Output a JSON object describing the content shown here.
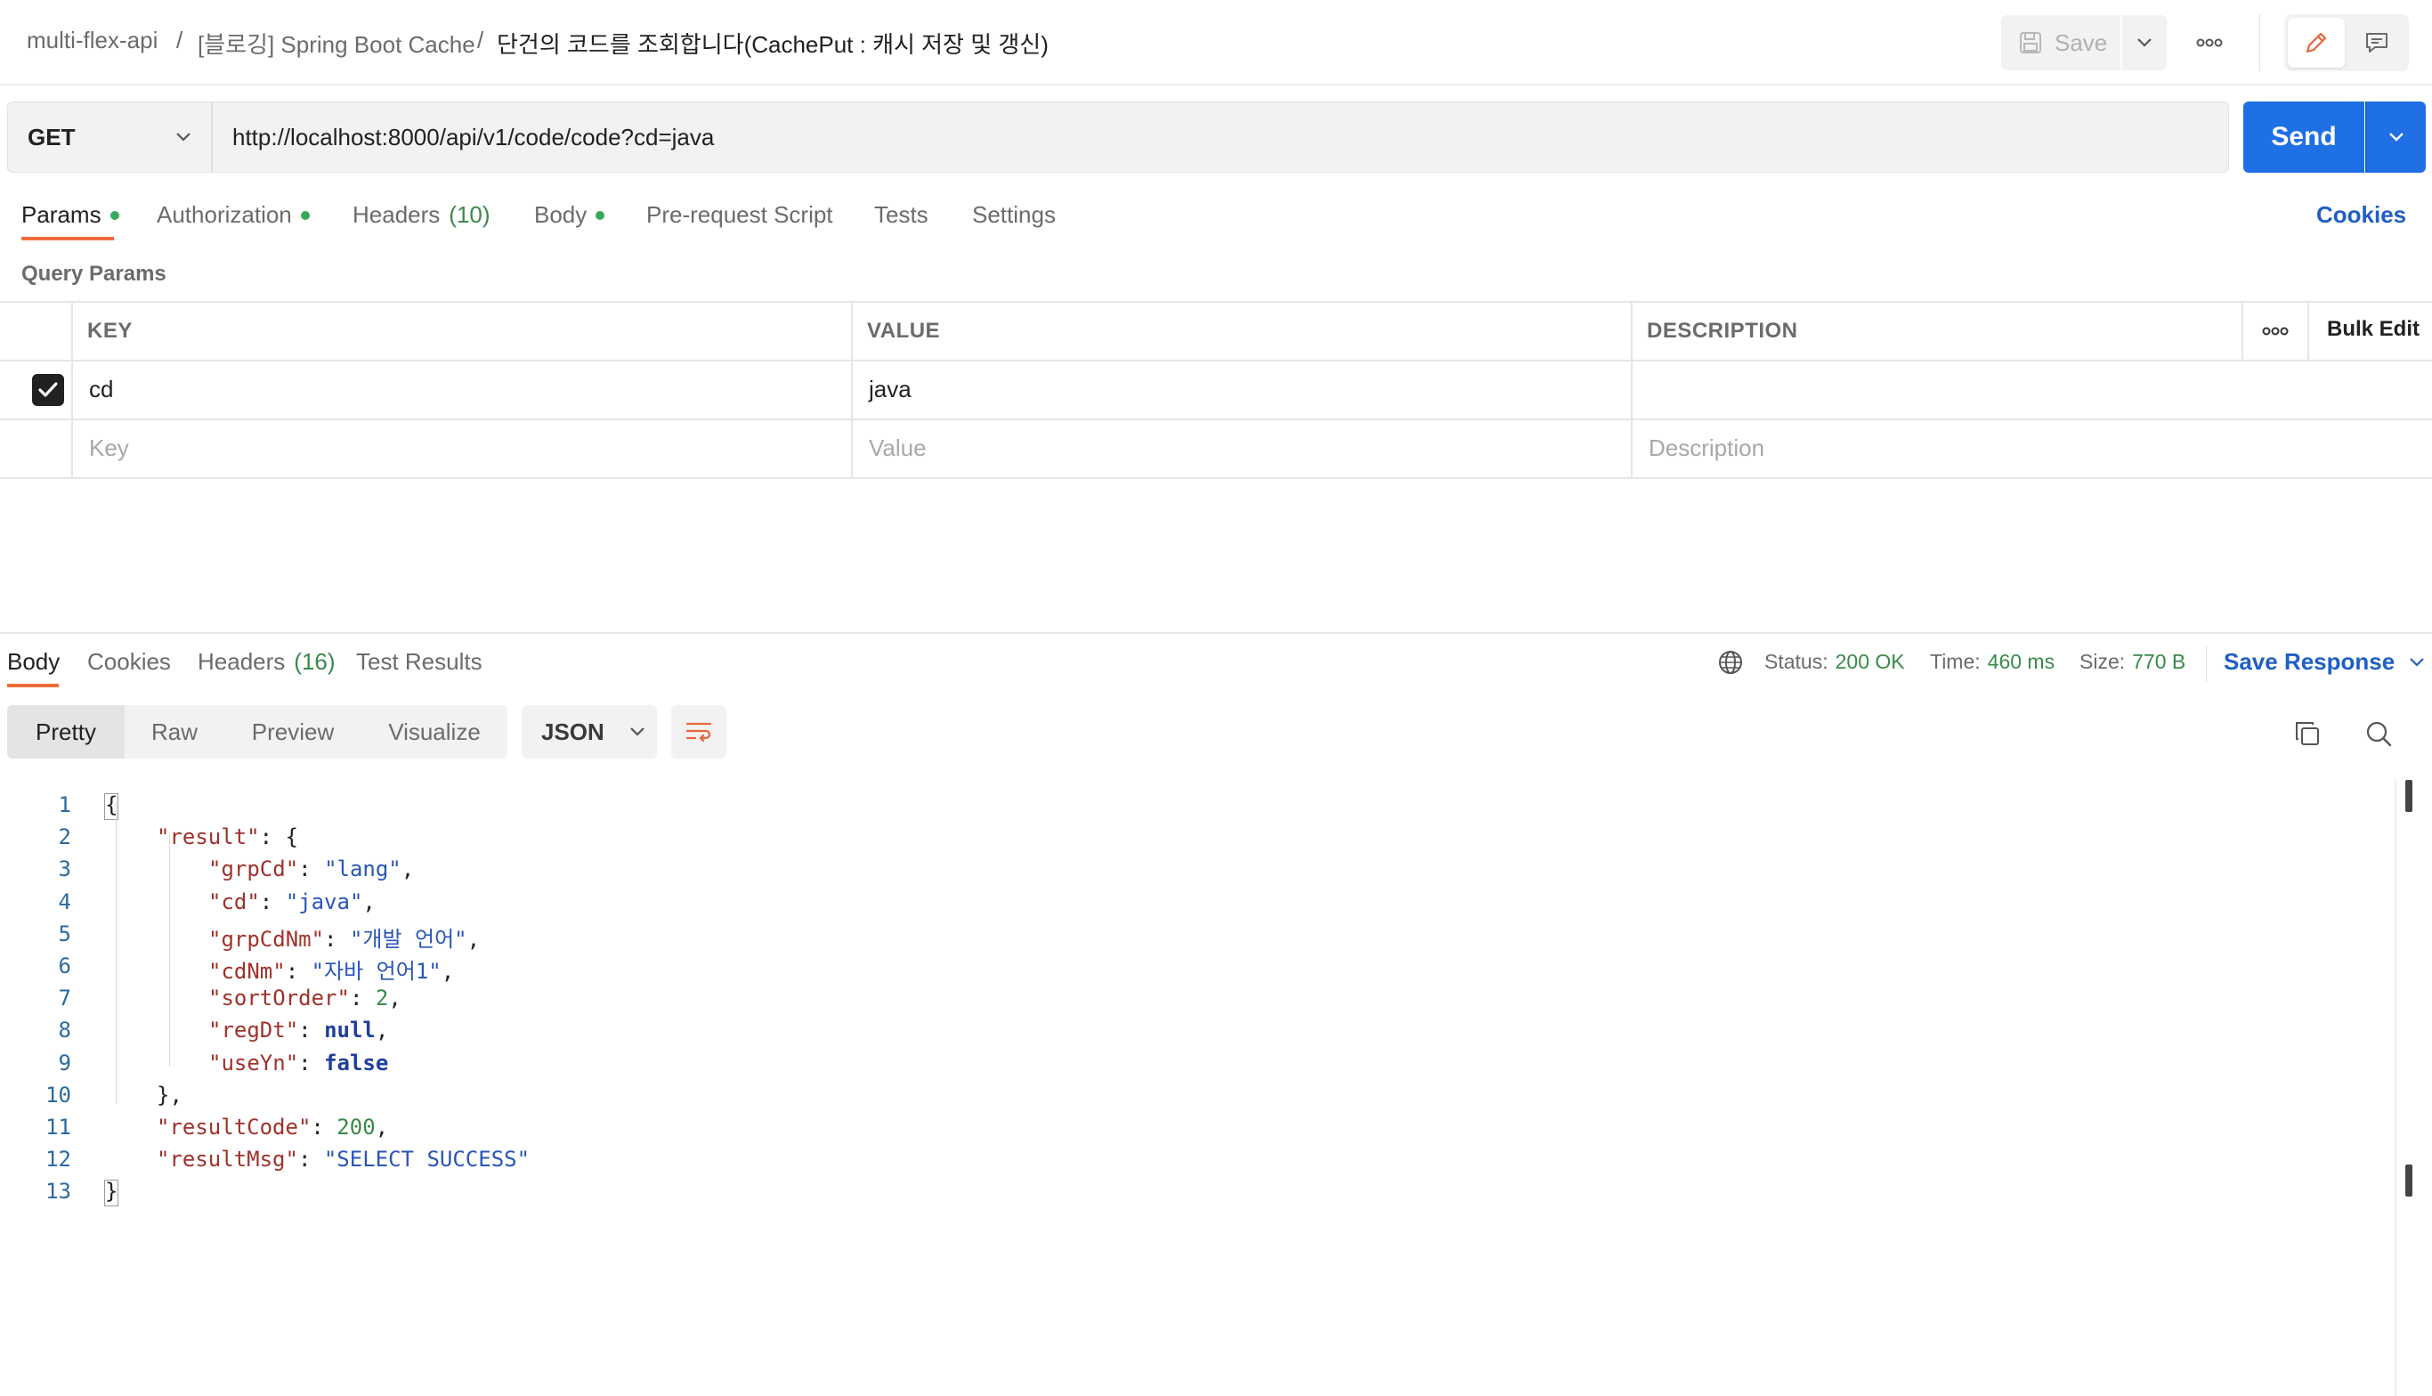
{
  "breadcrumb": {
    "collection": "multi-flex-api",
    "sep1": "/",
    "folder": "[블로깅] Spring Boot Cache",
    "sep2": "/",
    "request": "단건의 코드를 조회합니다(CachePut : 캐시 저장 및 갱신)"
  },
  "toolbar": {
    "save_label": "Save"
  },
  "request": {
    "method": "GET",
    "url": "http://localhost:8000/api/v1/code/code?cd=java",
    "send_label": "Send"
  },
  "request_tabs": {
    "params": "Params",
    "authorization": "Authorization",
    "headers": "Headers",
    "headers_count": "(10)",
    "body": "Body",
    "prerequest": "Pre-request Script",
    "tests": "Tests",
    "settings": "Settings",
    "cookies": "Cookies"
  },
  "query_params": {
    "title": "Query Params",
    "col_key": "KEY",
    "col_value": "VALUE",
    "col_description": "DESCRIPTION",
    "bulk_edit": "Bulk Edit",
    "rows": [
      {
        "key": "cd",
        "value": "java",
        "description": "",
        "checked": true
      }
    ],
    "placeholder_key": "Key",
    "placeholder_value": "Value",
    "placeholder_description": "Description"
  },
  "response_tabs": {
    "body": "Body",
    "cookies": "Cookies",
    "headers": "Headers",
    "headers_count": "(16)",
    "test_results": "Test Results"
  },
  "response_meta": {
    "status_label": "Status:",
    "status_value": "200 OK",
    "time_label": "Time:",
    "time_value": "460 ms",
    "size_label": "Size:",
    "size_value": "770 B",
    "save_response": "Save Response"
  },
  "view_modes": {
    "pretty": "Pretty",
    "raw": "Raw",
    "preview": "Preview",
    "visualize": "Visualize",
    "format": "JSON"
  },
  "response_body": {
    "line_numbers": [
      "1",
      "2",
      "3",
      "4",
      "5",
      "6",
      "7",
      "8",
      "9",
      "10",
      "11",
      "12",
      "13"
    ],
    "lines": [
      {
        "indent": 0,
        "tokens": [
          [
            "p",
            "{"
          ]
        ]
      },
      {
        "indent": 1,
        "tokens": [
          [
            "k",
            "\"result\""
          ],
          [
            "p",
            ": {"
          ]
        ]
      },
      {
        "indent": 2,
        "tokens": [
          [
            "k",
            "\"grpCd\""
          ],
          [
            "p",
            ": "
          ],
          [
            "s",
            "\"lang\""
          ],
          [
            "p",
            ","
          ]
        ]
      },
      {
        "indent": 2,
        "tokens": [
          [
            "k",
            "\"cd\""
          ],
          [
            "p",
            ": "
          ],
          [
            "s",
            "\"java\""
          ],
          [
            "p",
            ","
          ]
        ]
      },
      {
        "indent": 2,
        "tokens": [
          [
            "k",
            "\"grpCdNm\""
          ],
          [
            "p",
            ": "
          ],
          [
            "s",
            "\"개발 언어\""
          ],
          [
            "p",
            ","
          ]
        ]
      },
      {
        "indent": 2,
        "tokens": [
          [
            "k",
            "\"cdNm\""
          ],
          [
            "p",
            ": "
          ],
          [
            "s",
            "\"자바 언어1\""
          ],
          [
            "p",
            ","
          ]
        ]
      },
      {
        "indent": 2,
        "tokens": [
          [
            "k",
            "\"sortOrder\""
          ],
          [
            "p",
            ": "
          ],
          [
            "n",
            "2"
          ],
          [
            "p",
            ","
          ]
        ]
      },
      {
        "indent": 2,
        "tokens": [
          [
            "k",
            "\"regDt\""
          ],
          [
            "p",
            ": "
          ],
          [
            "kw",
            "null"
          ],
          [
            "p",
            ","
          ]
        ]
      },
      {
        "indent": 2,
        "tokens": [
          [
            "k",
            "\"useYn\""
          ],
          [
            "p",
            ": "
          ],
          [
            "kw",
            "false"
          ]
        ]
      },
      {
        "indent": 1,
        "tokens": [
          [
            "p",
            "},"
          ]
        ]
      },
      {
        "indent": 1,
        "tokens": [
          [
            "k",
            "\"resultCode\""
          ],
          [
            "p",
            ": "
          ],
          [
            "n",
            "200"
          ],
          [
            "p",
            ","
          ]
        ]
      },
      {
        "indent": 1,
        "tokens": [
          [
            "k",
            "\"resultMsg\""
          ],
          [
            "p",
            ": "
          ],
          [
            "s",
            "\"SELECT SUCCESS\""
          ]
        ]
      },
      {
        "indent": 0,
        "tokens": [
          [
            "p",
            "}"
          ]
        ]
      }
    ]
  },
  "colors": {
    "accent": "#1f6fe5",
    "tab_underline": "#f26b3a",
    "status_ok": "#3a8a4a"
  }
}
